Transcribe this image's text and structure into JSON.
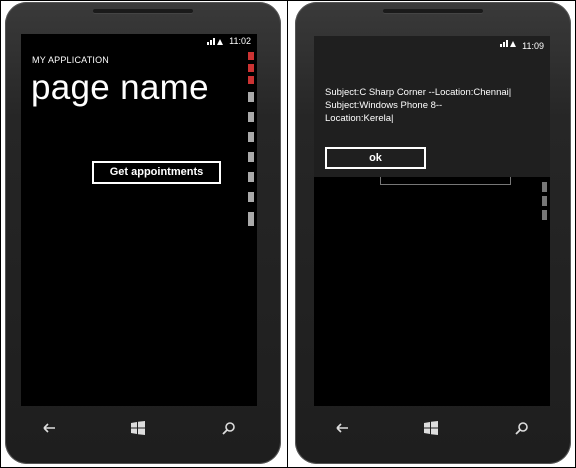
{
  "left_phone": {
    "status": {
      "time": "11:02"
    },
    "app_title": "MY APPLICATION",
    "page_title": "page name",
    "get_appointments_label": "Get appointments"
  },
  "right_phone": {
    "status": {
      "time": "11:09"
    },
    "message_lines": [
      "Subject:C Sharp Corner --Location:Chennai|",
      "Subject:Windows Phone 8--",
      "Location:Kerela|"
    ],
    "ok_label": "ok"
  },
  "nav_icons": [
    "back-icon",
    "windows-start-icon",
    "search-icon"
  ],
  "colors": {
    "screen": "#000000",
    "dialog": "#1f1f1f",
    "foreground": "#ffffff",
    "accent_debug": "#cc3333"
  }
}
